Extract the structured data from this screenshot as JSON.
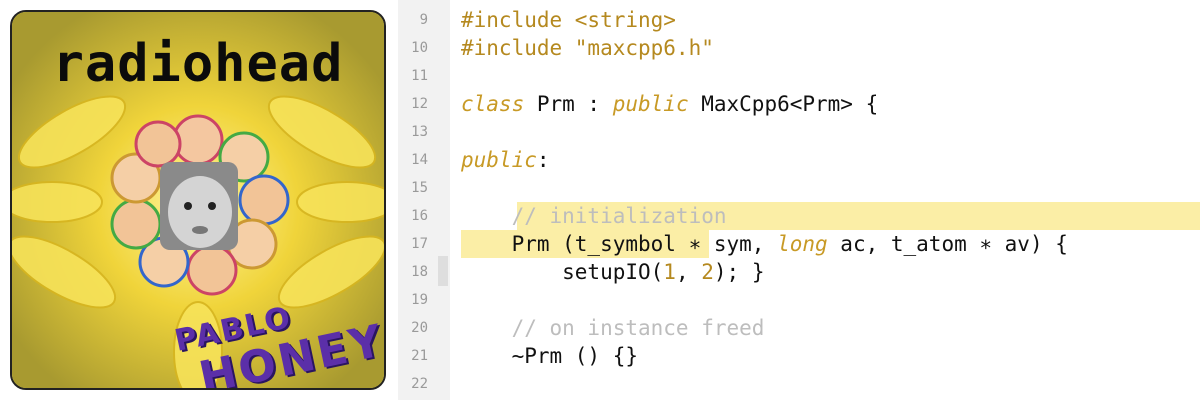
{
  "album": {
    "band_name": "radiohead",
    "title_line1": "PABLO",
    "title_line2": "HONEY"
  },
  "editor": {
    "lines": [
      {
        "num": "9",
        "tokens": [
          {
            "t": "#include <string>",
            "c": "kw"
          }
        ]
      },
      {
        "num": "10",
        "tokens": [
          {
            "t": "#include \"maxcpp6.h\"",
            "c": "kw"
          }
        ]
      },
      {
        "num": "11",
        "tokens": []
      },
      {
        "num": "12",
        "tokens": [
          {
            "t": "class",
            "c": "kwi"
          },
          {
            "t": " Prm : ",
            "c": ""
          },
          {
            "t": "public",
            "c": "kwi"
          },
          {
            "t": " MaxCpp6<Prm> {",
            "c": ""
          }
        ]
      },
      {
        "num": "13",
        "tokens": []
      },
      {
        "num": "14",
        "tokens": [
          {
            "t": "public",
            "c": "kwi"
          },
          {
            "t": ":",
            "c": ""
          }
        ]
      },
      {
        "num": "15",
        "tokens": []
      },
      {
        "num": "16",
        "tokens": [
          {
            "t": "    // initialization",
            "c": "cm"
          }
        ]
      },
      {
        "num": "17",
        "tokens": [
          {
            "t": "    Prm (t_symbol ∗ sym, ",
            "c": ""
          },
          {
            "t": "long",
            "c": "kwi"
          },
          {
            "t": " ac, t_atom ∗ av) {",
            "c": ""
          }
        ]
      },
      {
        "num": "18",
        "tokens": [
          {
            "t": "        setupIO(",
            "c": ""
          },
          {
            "t": "1",
            "c": "num"
          },
          {
            "t": ", ",
            "c": ""
          },
          {
            "t": "2",
            "c": "num"
          },
          {
            "t": "); }",
            "c": ""
          }
        ]
      },
      {
        "num": "19",
        "tokens": []
      },
      {
        "num": "20",
        "tokens": [
          {
            "t": "    // on instance freed",
            "c": "cm"
          }
        ]
      },
      {
        "num": "21",
        "tokens": [
          {
            "t": "    ~Prm () {}",
            "c": ""
          }
        ]
      },
      {
        "num": "22",
        "tokens": []
      }
    ]
  },
  "colors": {
    "keyword": "#b5891f",
    "comment": "#bdbdbd",
    "highlight": "#fbeea6",
    "album_purple": "#5b2fa8"
  }
}
